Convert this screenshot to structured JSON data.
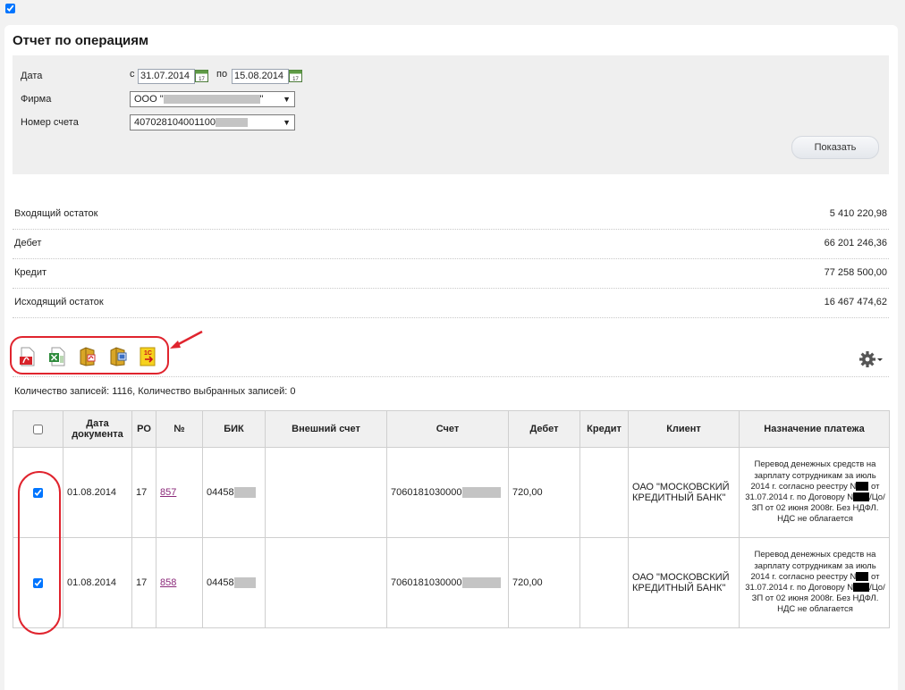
{
  "page": {
    "title": "Отчет по операциям"
  },
  "filters": {
    "date_label": "Дата",
    "date_from_prefix": "с",
    "date_from": "31.07.2014",
    "date_to_prefix": "по",
    "date_to": "15.08.2014",
    "firm_label": "Фирма",
    "firm_value_start": "ООО \"",
    "firm_value_end": "\"",
    "account_label": "Номер счета",
    "account_value": "407028104001100",
    "show_button": "Показать"
  },
  "balances": [
    {
      "label": "Входящий остаток",
      "value": "5 410 220,98"
    },
    {
      "label": "Дебет",
      "value": "66 201 246,36"
    },
    {
      "label": "Кредит",
      "value": "77 258 500,00"
    },
    {
      "label": "Исходящий остаток",
      "value": "16 467 474,62"
    }
  ],
  "toolbar": {
    "icons": [
      "pdf-export-icon",
      "excel-export-icon",
      "pdf-archive-export-icon",
      "word-archive-export-icon",
      "1c-export-icon"
    ],
    "settings_icon": "gear-icon",
    "annotation_color": "#e0242e"
  },
  "records": {
    "summary": "Количество записей: 1116, Количество выбранных записей: 0"
  },
  "table": {
    "headers": {
      "date": "Дата документа",
      "ro": "РО",
      "num": "№",
      "bik": "БИК",
      "ext_account": "Внешний счет",
      "account": "Счет",
      "debit": "Дебет",
      "credit": "Кредит",
      "client": "Клиент",
      "purpose": "Назначение платежа"
    },
    "rows": [
      {
        "checked": true,
        "date": "01.08.2014",
        "ro": "17",
        "num": "857",
        "bik": "04458",
        "ext_account": "",
        "account": "7060181030000",
        "debit": "720,00",
        "credit": "",
        "client": "ОАО \"МОСКОВСКИЙ КРЕДИТНЫЙ БАНК\"",
        "purpose_1": "Перевод денежных средств на зарплату сотрудникам за июль 2014 г. согласно реестру N",
        "purpose_2": "от 31.07.2014 г. по Договору N",
        "purpose_3": "/Цо/ЗП от",
        "purpose_4": "02 июня 2008г. Без НДФЛ. НДС не облагается"
      },
      {
        "checked": true,
        "date": "01.08.2014",
        "ro": "17",
        "num": "858",
        "bik": "04458",
        "ext_account": "",
        "account": "7060181030000",
        "debit": "720,00",
        "credit": "",
        "client": "ОАО \"МОСКОВСКИЙ КРЕДИТНЫЙ БАНК\"",
        "purpose_1": "Перевод денежных средств на зарплату сотрудникам за июль 2014 г. согласно реестру N",
        "purpose_2": "от 31.07.2014 г. по Договору N",
        "purpose_3": "/Цо/ЗП от",
        "purpose_4": "02 июня 2008г. Без НДФЛ. НДС не облагается"
      }
    ]
  }
}
